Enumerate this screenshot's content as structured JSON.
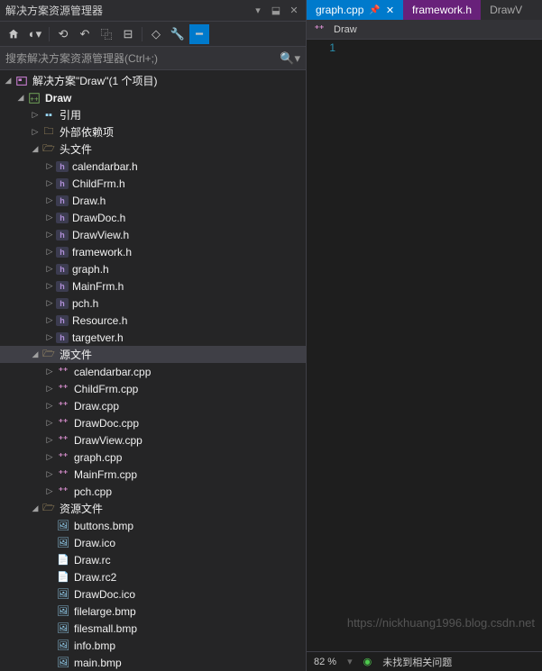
{
  "panel": {
    "title": "解决方案资源管理器",
    "search_placeholder": "搜索解决方案资源管理器(Ctrl+;)"
  },
  "tree": {
    "solution": {
      "label": "解决方案\"Draw\"(1 个项目)"
    },
    "project": {
      "label": "Draw"
    },
    "refs": {
      "label": "引用"
    },
    "external": {
      "label": "外部依赖项"
    },
    "headers": {
      "label": "头文件",
      "items": [
        "calendarbar.h",
        "ChildFrm.h",
        "Draw.h",
        "DrawDoc.h",
        "DrawView.h",
        "framework.h",
        "graph.h",
        "MainFrm.h",
        "pch.h",
        "Resource.h",
        "targetver.h"
      ]
    },
    "sources": {
      "label": "源文件",
      "items": [
        "calendarbar.cpp",
        "ChildFrm.cpp",
        "Draw.cpp",
        "DrawDoc.cpp",
        "DrawView.cpp",
        "graph.cpp",
        "MainFrm.cpp",
        "pch.cpp"
      ]
    },
    "resources": {
      "label": "资源文件",
      "items": [
        "buttons.bmp",
        "Draw.ico",
        "Draw.rc",
        "Draw.rc2",
        "DrawDoc.ico",
        "filelarge.bmp",
        "filesmall.bmp",
        "info.bmp",
        "main.bmp"
      ]
    }
  },
  "editor": {
    "tabs": [
      {
        "label": "graph.cpp",
        "active": true,
        "pinned": true
      },
      {
        "label": "framework.h",
        "preview": true
      },
      {
        "label": "DrawV"
      }
    ],
    "nav": "Draw",
    "line1": "1"
  },
  "status": {
    "zoom": "82 %",
    "issues": "未找到相关问题"
  },
  "watermark": "https://nickhuang1996.blog.csdn.net"
}
